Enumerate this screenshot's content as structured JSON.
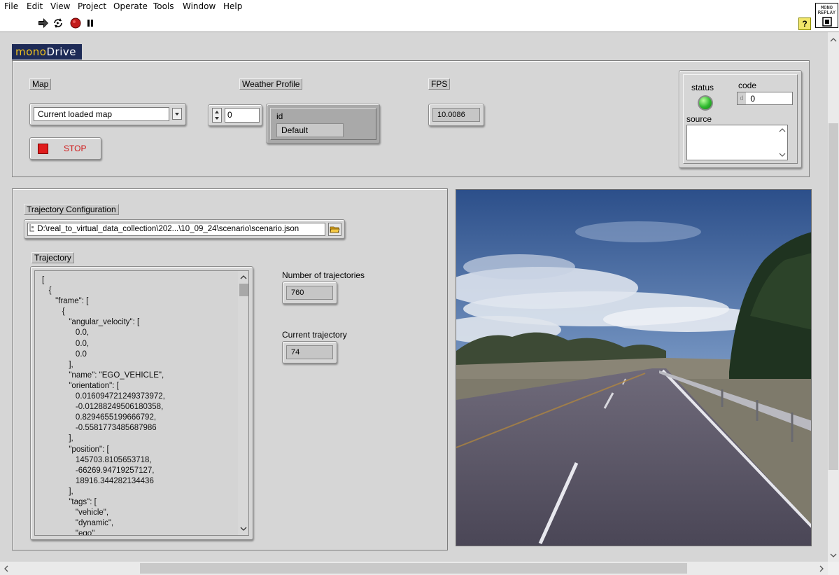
{
  "menu": [
    "File",
    "Edit",
    "View",
    "Project",
    "Operate",
    "Tools",
    "Window",
    "Help"
  ],
  "toolbar": {
    "run_icon": "run-arrow-icon",
    "run_continuous_icon": "run-continuously-icon",
    "abort_icon": "abort-stop-icon",
    "pause_icon": "pause-icon",
    "help_label": "?"
  },
  "logo": {
    "line1": "MONO",
    "line2": "REPLAY"
  },
  "brand": {
    "part1": "mono",
    "part2": "Drive"
  },
  "map": {
    "label": "Map",
    "value": "Current loaded map"
  },
  "stop_button": {
    "label": "STOP"
  },
  "weather": {
    "label": "Weather Profile",
    "index": "0",
    "id_label": "id",
    "id_value": "Default"
  },
  "fps": {
    "label": "FPS",
    "value": "10.0086"
  },
  "error_cluster": {
    "status_label": "status",
    "code_label": "code",
    "code_prefix": "d",
    "code_value": "0",
    "source_label": "source",
    "source_value": "",
    "status_color": "#2db82d"
  },
  "trajectory_config": {
    "label": "Trajectory Configuration",
    "path": "D:\\real_to_virtual_data_collection\\202...\\10_09_24\\scenario\\scenario.json"
  },
  "trajectory": {
    "label": "Trajectory",
    "text": "[\n   {\n      \"frame\": [\n         {\n            \"angular_velocity\": [\n               0.0,\n               0.0,\n               0.0\n            ],\n            \"name\": \"EGO_VEHICLE\",\n            \"orientation\": [\n               0.016094721249373972,\n               -0.01288249506180358,\n               0.8294655199666792,\n               -0.5581773485687986\n            ],\n            \"position\": [\n               145703.8105653718,\n               -66269.94719257127,\n               18916.344282134436\n            ],\n            \"tags\": [\n               \"vehicle\",\n               \"dynamic\",\n               \"ego\""
  },
  "num_trajectories": {
    "label": "Number of trajectories",
    "value": "760"
  },
  "current_trajectory": {
    "label": "Current trajectory",
    "value": "74"
  }
}
